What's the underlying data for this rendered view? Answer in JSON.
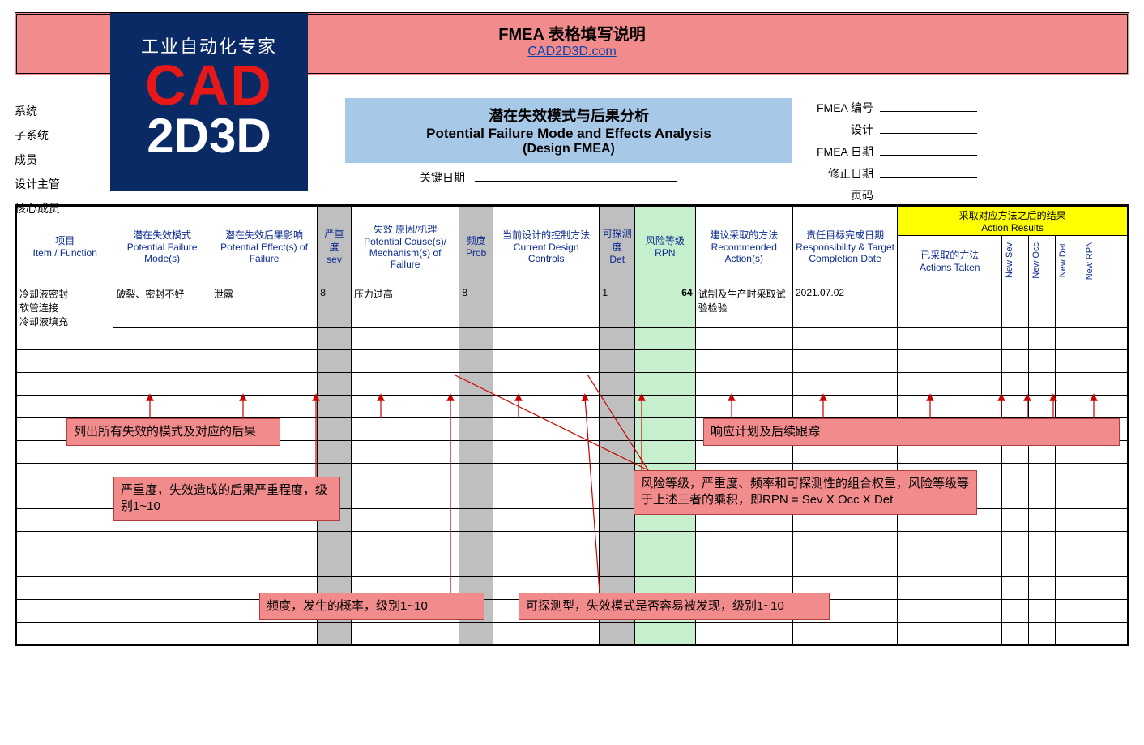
{
  "title": {
    "main": "FMEA 表格填写说明",
    "link": "CAD2D3D.com"
  },
  "logo": {
    "tagline": "工业自动化专家",
    "line1": "CAD",
    "line2": "2D3D"
  },
  "meta_left": {
    "system": "系统",
    "subsystem": "子系统",
    "member": "成员",
    "design_lead": "设计主管",
    "core_member": "核心成员"
  },
  "center": {
    "cn": "潜在失效模式与后果分析",
    "en": "Potential Failure Mode and Effects Analysis",
    "sub": "(Design FMEA)",
    "key_date_label": "关键日期"
  },
  "meta_right": {
    "fmea_no": "FMEA 编号",
    "design": "设计",
    "fmea_date": "FMEA 日期",
    "rev_date": "修正日期",
    "page": "页码"
  },
  "table": {
    "headers": {
      "item": "项目\nItem / Function",
      "mode": "潜在失效模式\nPotential Failure Mode(s)",
      "effect": "潜在失效后果影响\nPotential Effect(s) of Failure",
      "sev": "严重度\nsev",
      "cause": "失效 原因/机理\nPotential Cause(s)/ Mechanism(s) of Failure",
      "prob": "频度\nProb",
      "controls": "当前设计的控制方法\nCurrent Design Controls",
      "det": "可探测度\nDet",
      "rpn": "风险等级\nRPN",
      "rec": "建议采取的方法\nRecommended Action(s)",
      "resp": "责任目标完成日期\nResponsibility & Target Completion Date",
      "action_results": "采取对应方法之后的结果\nAction Results",
      "taken": "已采取的方法\nActions Taken",
      "new_sev": "New Sev",
      "new_occ": "New Occ",
      "new_det": "New Det",
      "new_rpn": "New RPN"
    },
    "row1": {
      "item": "冷却液密封\n软管连接\n冷却液填充",
      "mode": "破裂、密封不好",
      "effect": "泄露",
      "sev": "8",
      "cause": "压力过高",
      "prob": "8",
      "controls": "",
      "det": "1",
      "rpn": "64",
      "rec": "试制及生产时采取试验检验",
      "resp": "2021.07.02"
    }
  },
  "annotations": {
    "a1": "列出所有失效的模式及对应的后果",
    "a2": "严重度，失效造成的后果严重程度，级别1~10",
    "a3": "频度，发生的概率，级别1~10",
    "a4": "可探测型，失效模式是否容易被发现，级别1~10",
    "a5": "风险等级，严重度、频率和可探测性的组合权重，风险等级等于上述三者的乘积，即RPN = Sev X Occ X Det",
    "a6": "响应计划及后续跟踪"
  }
}
